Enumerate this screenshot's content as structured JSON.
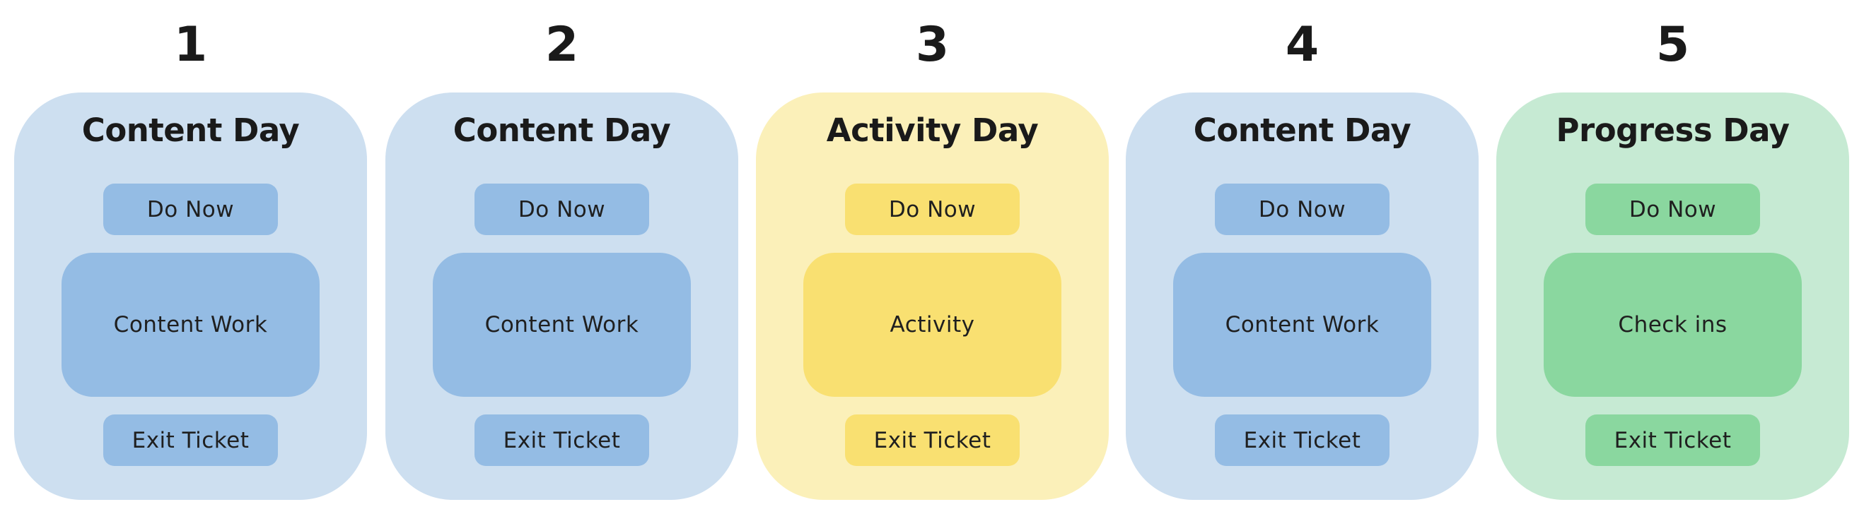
{
  "palette": {
    "blue": {
      "card": "#cddff0",
      "box": "#94bce4"
    },
    "yellow": {
      "card": "#fbf0b9",
      "box": "#f9e071"
    },
    "green": {
      "card": "#c6ead3",
      "box": "#8ad79f"
    }
  },
  "days": [
    {
      "number": "1",
      "title": "Content Day",
      "theme": "blue",
      "do_now": "Do Now",
      "main": "Content Work",
      "exit": "Exit Ticket"
    },
    {
      "number": "2",
      "title": "Content Day",
      "theme": "blue",
      "do_now": "Do Now",
      "main": "Content Work",
      "exit": "Exit Ticket"
    },
    {
      "number": "3",
      "title": "Activity Day",
      "theme": "yellow",
      "do_now": "Do Now",
      "main": "Activity",
      "exit": "Exit Ticket"
    },
    {
      "number": "4",
      "title": "Content Day",
      "theme": "blue",
      "do_now": "Do Now",
      "main": "Content Work",
      "exit": "Exit Ticket"
    },
    {
      "number": "5",
      "title": "Progress Day",
      "theme": "green",
      "do_now": "Do Now",
      "main": "Check ins",
      "exit": "Exit Ticket"
    }
  ]
}
